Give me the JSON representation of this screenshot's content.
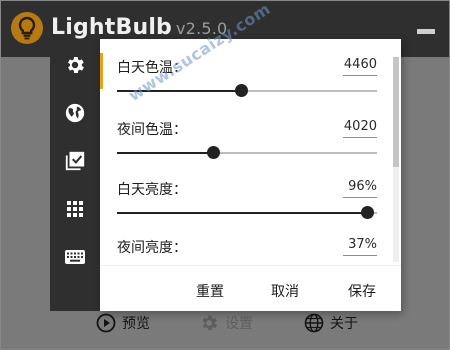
{
  "app": {
    "name": "LightBulb",
    "version": "v2.5.0"
  },
  "sidebar": {
    "items": [
      {
        "icon": "gear-icon"
      },
      {
        "icon": "globe-icon"
      },
      {
        "icon": "checklist-icon"
      },
      {
        "icon": "grid-icon"
      },
      {
        "icon": "keyboard-icon"
      }
    ]
  },
  "settings": [
    {
      "label": "白天色温：",
      "value": "4460",
      "level": 0.475
    },
    {
      "label": "夜间色温：",
      "value": "4020",
      "level": 0.37
    },
    {
      "label": "白天亮度：",
      "value": "96%",
      "level": 0.96
    },
    {
      "label": "夜间亮度：",
      "value": "37%",
      "level": 0.37
    }
  ],
  "panel_buttons": {
    "reset": "重置",
    "cancel": "取消",
    "save": "保存"
  },
  "bottom_bar": {
    "preview": "预览",
    "settings": "设置",
    "about": "关于"
  },
  "watermark": "www.sucaizy.com",
  "colors": {
    "accent": "#e6a21b",
    "sidebar": "#2f2f2f",
    "titlebar": "#2f2f2f",
    "logo": "#b57a16"
  }
}
